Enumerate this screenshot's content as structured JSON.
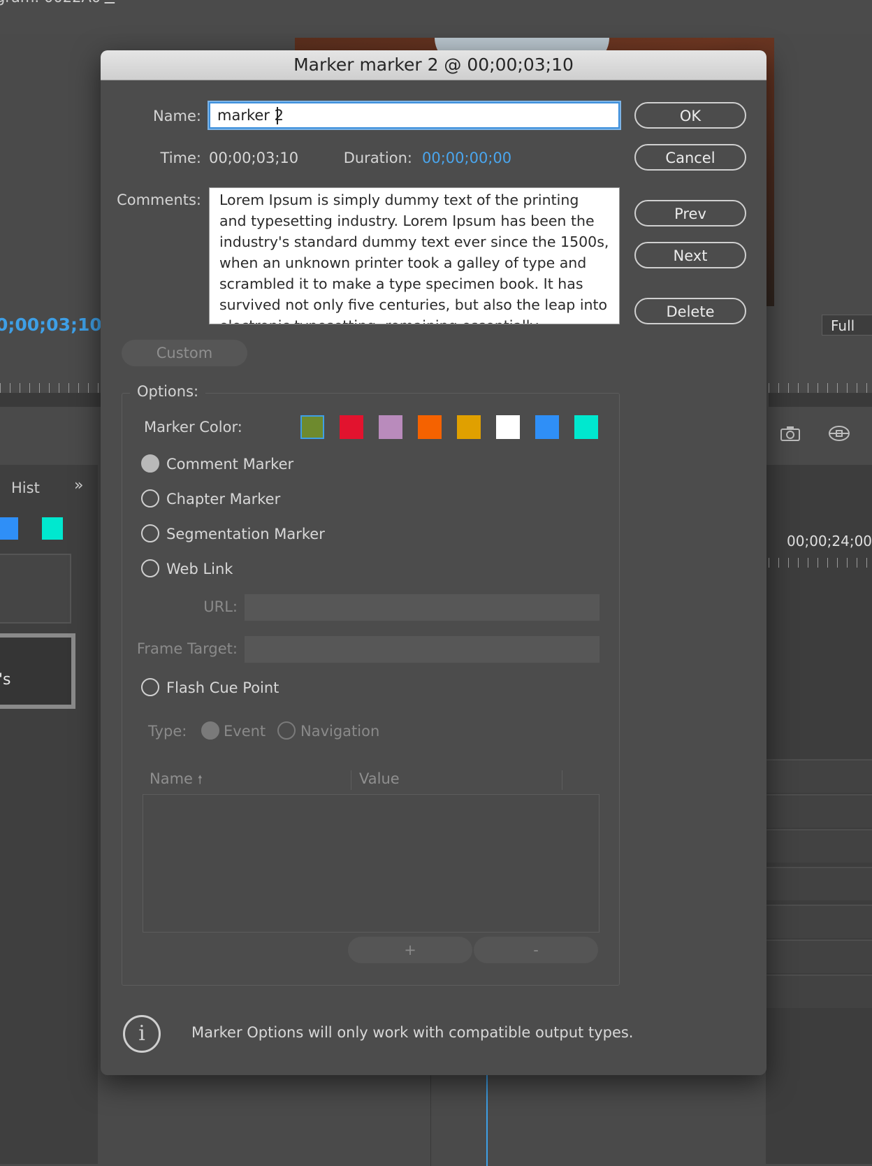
{
  "background": {
    "panel_title": "gram: 0022A0",
    "menu_icon": "hamburger-icon",
    "timecode_left": "0;00;03;10",
    "zoom_select": "Full",
    "history_tab": "Hist",
    "clip_label": "'s",
    "timeline_time": "00;00;24;00",
    "colors": {
      "timecode": "#3e9fe6"
    }
  },
  "dialog": {
    "title": "Marker marker 2 @ 00;00;03;10",
    "name_label": "Name:",
    "name_value": "marker 2",
    "time_label": "Time:",
    "time_value": "00;00;03;10",
    "duration_label": "Duration:",
    "duration_value": "00;00;00;00",
    "comments_label": "Comments:",
    "comments_value": "Lorem Ipsum is simply dummy text of the printing and typesetting industry. Lorem Ipsum has been the industry's standard dummy text ever since the 1500s, when an unknown printer took a galley of type and scrambled it to make a type specimen book. It has survived not only five centuries, but also the leap into electronic typesetting, remaining essentially unchanged.",
    "buttons": {
      "ok": "OK",
      "cancel": "Cancel",
      "prev": "Prev",
      "next": "Next",
      "delete": "Delete"
    },
    "custom_button": "Custom",
    "options": {
      "legend": "Options:",
      "marker_color_label": "Marker Color:",
      "colors": [
        "#6e8a2e",
        "#e2132e",
        "#b98bbc",
        "#f56200",
        "#e0a000",
        "#ffffff",
        "#2f8ff7",
        "#00e8cf"
      ],
      "selected_color_index": 0,
      "marker_types": [
        "Comment Marker",
        "Chapter Marker",
        "Segmentation Marker",
        "Web Link"
      ],
      "selected_marker_type": "Comment Marker",
      "url_label": "URL:",
      "frame_target_label": "Frame Target:",
      "flash_cue_point": "Flash Cue Point",
      "type_label": "Type:",
      "type_event": "Event",
      "type_navigation": "Navigation",
      "table_columns": [
        "Name",
        "Value"
      ],
      "add_button": "+",
      "remove_button": "-"
    },
    "info_icon": "info-icon",
    "info_text": "Marker Options will only work with compatible output types."
  }
}
